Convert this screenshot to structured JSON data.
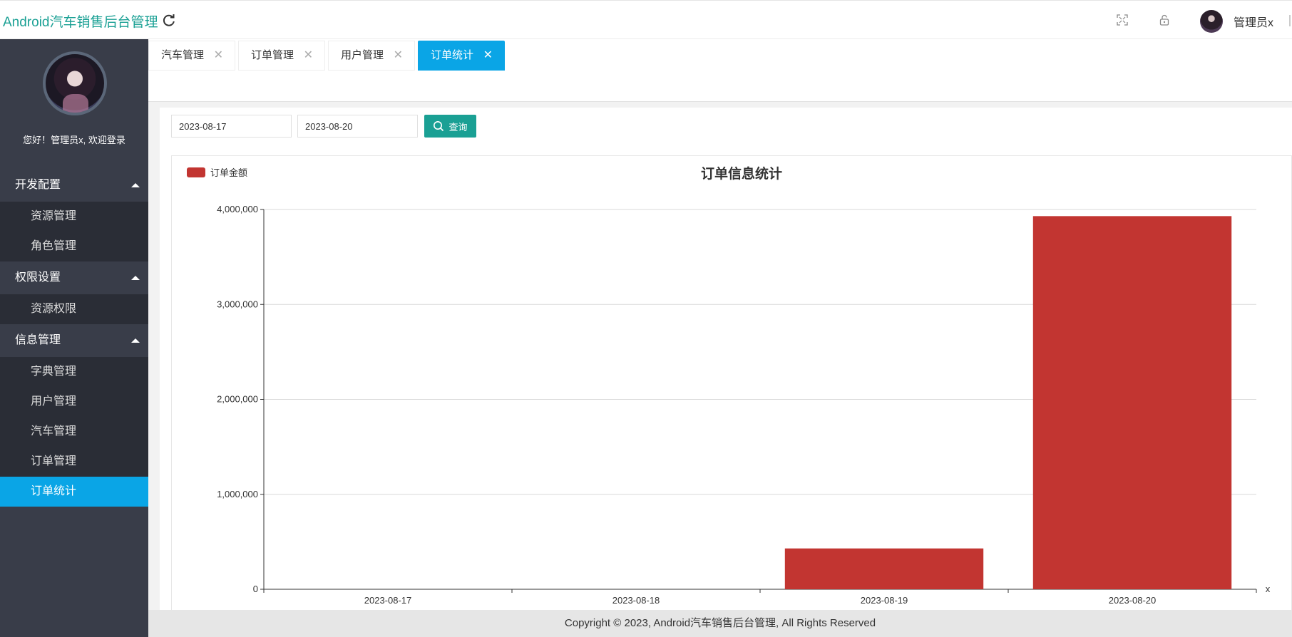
{
  "header": {
    "app_title": "Android汽车销售后台管理",
    "user_name": "管理员x"
  },
  "sidebar": {
    "welcome": "您好！管理员x, 欢迎登录",
    "groups": [
      {
        "label": "开发配置",
        "items": [
          {
            "label": "资源管理"
          },
          {
            "label": "角色管理"
          }
        ]
      },
      {
        "label": "权限设置",
        "items": [
          {
            "label": "资源权限"
          }
        ]
      },
      {
        "label": "信息管理",
        "items": [
          {
            "label": "字典管理"
          },
          {
            "label": "用户管理"
          },
          {
            "label": "汽车管理"
          },
          {
            "label": "订单管理"
          },
          {
            "label": "订单统计"
          }
        ]
      }
    ],
    "active_item": "订单统计"
  },
  "tabs": [
    {
      "label": "汽车管理",
      "active": false
    },
    {
      "label": "订单管理",
      "active": false
    },
    {
      "label": "用户管理",
      "active": false
    },
    {
      "label": "订单统计",
      "active": true
    }
  ],
  "filters": {
    "start_date": "2023-08-17",
    "end_date": "2023-08-20",
    "query_label": "查询"
  },
  "chart_data": {
    "type": "bar",
    "title": "订单信息统计",
    "xlabel": "x",
    "ylabel": "",
    "legend": "top-left",
    "grid": true,
    "categories": [
      "2023-08-17",
      "2023-08-18",
      "2023-08-19",
      "2023-08-20"
    ],
    "series": [
      {
        "name": "订单金额",
        "values": [
          0,
          0,
          430000,
          3930000
        ],
        "color": "#c23531"
      }
    ],
    "ylim": [
      0,
      4000000
    ],
    "yticks": [
      "0",
      "1,000,000",
      "2,000,000",
      "3,000,000",
      "4,000,000"
    ]
  },
  "footer": {
    "copyright": "Copyright © 2023, Android汽车销售后台管理, All Rights Reserved"
  }
}
